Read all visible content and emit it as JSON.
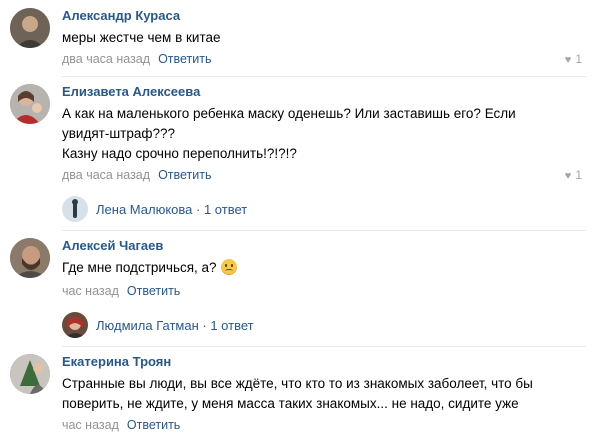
{
  "comments": [
    {
      "author": "Александр Кураса",
      "lines": [
        "меры жестче чем в китае"
      ],
      "time": "два часа назад",
      "reply": "Ответить",
      "likes": "1",
      "colors": {
        "avatar_bg": "#7a6a5a",
        "avatar_fg": "#c9a88a"
      }
    },
    {
      "author": "Елизавета Алексеева",
      "lines": [
        "А как на маленького ребенка маску оденешь? Или заставишь его? Если",
        "увидят-штраф???",
        "Казну надо срочно переполнить!?!?!?"
      ],
      "time": "два часа назад",
      "reply": "Ответить",
      "likes": "1",
      "thread": {
        "name": "Лена Малюкова",
        "count": "1 ответ"
      }
    },
    {
      "author": "Алексей Чагаев",
      "lines": [
        "Где мне подстричься, а?"
      ],
      "emoji": "worried-face-icon",
      "time": "час назад",
      "reply": "Ответить",
      "thread": {
        "name": "Людмила Гатман",
        "count": "1 ответ"
      }
    },
    {
      "author": "Екатерина Троян",
      "lines": [
        "Странные вы люди, вы все ждёте, что кто то из знакомых заболеет, что бы",
        "поверить, не ждите, у меня масса таких знакомых... не надо, сидите уже"
      ],
      "time": "час назад",
      "reply": "Ответить"
    }
  ],
  "theme": {
    "link": "#2a5885",
    "muted": "#939393",
    "divider": "#e7e8ec"
  }
}
